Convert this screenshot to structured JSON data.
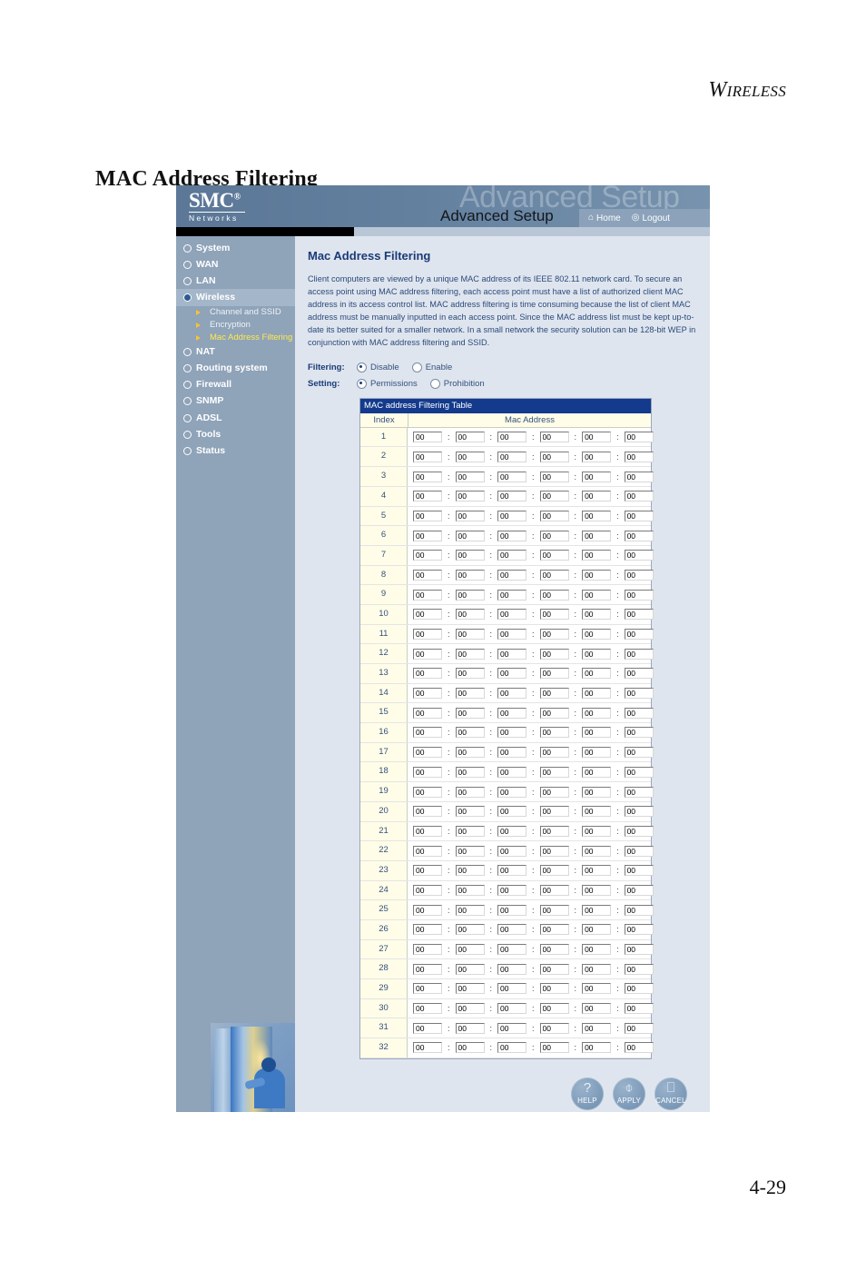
{
  "document": {
    "running_header": "WIRELESS",
    "running_header_cap": "W",
    "running_header_rest": "IRELESS",
    "title": "MAC Address Filtering",
    "page_number": "4-29"
  },
  "ui": {
    "brand": {
      "logo": "SMC",
      "logo_reg": "®",
      "logo_sub": "Networks",
      "watermark": "Advanced Setup",
      "title": "Advanced Setup"
    },
    "nav_buttons": [
      {
        "label": "Home",
        "icon": "home-icon",
        "glyph": "⌂"
      },
      {
        "label": "Logout",
        "icon": "logout-icon",
        "glyph": "◎"
      }
    ],
    "sidebar": {
      "items": [
        {
          "label": "System",
          "active": false
        },
        {
          "label": "WAN",
          "active": false
        },
        {
          "label": "LAN",
          "active": false
        },
        {
          "label": "Wireless",
          "active": true
        },
        {
          "label": "NAT",
          "active": false
        },
        {
          "label": "Routing system",
          "active": false
        },
        {
          "label": "Firewall",
          "active": false
        },
        {
          "label": "SNMP",
          "active": false
        },
        {
          "label": "ADSL",
          "active": false
        },
        {
          "label": "Tools",
          "active": false
        },
        {
          "label": "Status",
          "active": false
        }
      ],
      "sub_items": [
        {
          "label": "Channel and SSID",
          "selected": false
        },
        {
          "label": "Encryption",
          "selected": false
        },
        {
          "label": "Mac Address Filtering",
          "selected": true
        }
      ]
    },
    "content": {
      "title": "Mac Address Filtering",
      "description": "Client computers are viewed by a unique MAC address of its IEEE 802.11 network card. To secure an access point using MAC address filtering, each access point must have a list of authorized client MAC address in its access control list. MAC address filtering is time consuming because the list of client MAC address must be manually inputted in each access point. Since the MAC address list must be kept up-to-date its better suited for a smaller network. In a small network the security solution can be 128-bit WEP in conjunction with MAC address filtering and SSID.",
      "filtering": {
        "label": "Filtering:",
        "options": [
          {
            "label": "Disable",
            "checked": true
          },
          {
            "label": "Enable",
            "checked": false
          }
        ]
      },
      "setting": {
        "label": "Setting:",
        "options": [
          {
            "label": "Permissions",
            "checked": true
          },
          {
            "label": "Prohibition",
            "checked": false
          }
        ]
      },
      "table": {
        "title": "MAC address Filtering Table",
        "columns": [
          "Index",
          "Mac Address"
        ],
        "separator": ":",
        "octet_default": "00",
        "rows": [
          {
            "index": "1",
            "octets": [
              "00",
              "00",
              "00",
              "00",
              "00",
              "00"
            ]
          },
          {
            "index": "2",
            "octets": [
              "00",
              "00",
              "00",
              "00",
              "00",
              "00"
            ]
          },
          {
            "index": "3",
            "octets": [
              "00",
              "00",
              "00",
              "00",
              "00",
              "00"
            ]
          },
          {
            "index": "4",
            "octets": [
              "00",
              "00",
              "00",
              "00",
              "00",
              "00"
            ]
          },
          {
            "index": "5",
            "octets": [
              "00",
              "00",
              "00",
              "00",
              "00",
              "00"
            ]
          },
          {
            "index": "6",
            "octets": [
              "00",
              "00",
              "00",
              "00",
              "00",
              "00"
            ]
          },
          {
            "index": "7",
            "octets": [
              "00",
              "00",
              "00",
              "00",
              "00",
              "00"
            ]
          },
          {
            "index": "8",
            "octets": [
              "00",
              "00",
              "00",
              "00",
              "00",
              "00"
            ]
          },
          {
            "index": "9",
            "octets": [
              "00",
              "00",
              "00",
              "00",
              "00",
              "00"
            ]
          },
          {
            "index": "10",
            "octets": [
              "00",
              "00",
              "00",
              "00",
              "00",
              "00"
            ]
          },
          {
            "index": "11",
            "octets": [
              "00",
              "00",
              "00",
              "00",
              "00",
              "00"
            ]
          },
          {
            "index": "12",
            "octets": [
              "00",
              "00",
              "00",
              "00",
              "00",
              "00"
            ]
          },
          {
            "index": "13",
            "octets": [
              "00",
              "00",
              "00",
              "00",
              "00",
              "00"
            ]
          },
          {
            "index": "14",
            "octets": [
              "00",
              "00",
              "00",
              "00",
              "00",
              "00"
            ]
          },
          {
            "index": "15",
            "octets": [
              "00",
              "00",
              "00",
              "00",
              "00",
              "00"
            ]
          },
          {
            "index": "16",
            "octets": [
              "00",
              "00",
              "00",
              "00",
              "00",
              "00"
            ]
          },
          {
            "index": "17",
            "octets": [
              "00",
              "00",
              "00",
              "00",
              "00",
              "00"
            ]
          },
          {
            "index": "18",
            "octets": [
              "00",
              "00",
              "00",
              "00",
              "00",
              "00"
            ]
          },
          {
            "index": "19",
            "octets": [
              "00",
              "00",
              "00",
              "00",
              "00",
              "00"
            ]
          },
          {
            "index": "20",
            "octets": [
              "00",
              "00",
              "00",
              "00",
              "00",
              "00"
            ]
          },
          {
            "index": "21",
            "octets": [
              "00",
              "00",
              "00",
              "00",
              "00",
              "00"
            ]
          },
          {
            "index": "22",
            "octets": [
              "00",
              "00",
              "00",
              "00",
              "00",
              "00"
            ]
          },
          {
            "index": "23",
            "octets": [
              "00",
              "00",
              "00",
              "00",
              "00",
              "00"
            ]
          },
          {
            "index": "24",
            "octets": [
              "00",
              "00",
              "00",
              "00",
              "00",
              "00"
            ]
          },
          {
            "index": "25",
            "octets": [
              "00",
              "00",
              "00",
              "00",
              "00",
              "00"
            ]
          },
          {
            "index": "26",
            "octets": [
              "00",
              "00",
              "00",
              "00",
              "00",
              "00"
            ]
          },
          {
            "index": "27",
            "octets": [
              "00",
              "00",
              "00",
              "00",
              "00",
              "00"
            ]
          },
          {
            "index": "28",
            "octets": [
              "00",
              "00",
              "00",
              "00",
              "00",
              "00"
            ]
          },
          {
            "index": "29",
            "octets": [
              "00",
              "00",
              "00",
              "00",
              "00",
              "00"
            ]
          },
          {
            "index": "30",
            "octets": [
              "00",
              "00",
              "00",
              "00",
              "00",
              "00"
            ]
          },
          {
            "index": "31",
            "octets": [
              "00",
              "00",
              "00",
              "00",
              "00",
              "00"
            ]
          },
          {
            "index": "32",
            "octets": [
              "00",
              "00",
              "00",
              "00",
              "00",
              "00"
            ]
          }
        ]
      },
      "actions": [
        {
          "label": "HELP",
          "icon": "question-mark-icon",
          "glyph": "?"
        },
        {
          "label": "APPLY",
          "icon": "mouse-icon",
          "glyph": "⌕"
        },
        {
          "label": "CANCEL",
          "icon": "trash-can-icon",
          "glyph": "Ὕ1"
        }
      ]
    }
  },
  "colors": {
    "brand_band": "#63809f",
    "sidebar": "#8fa3b9",
    "content_bg": "#dfe5ee",
    "table_header": "#133a8c",
    "index_bg": "#fffde8",
    "accent_text": "#1b3a78",
    "selected_nav": "#ffe94d"
  }
}
